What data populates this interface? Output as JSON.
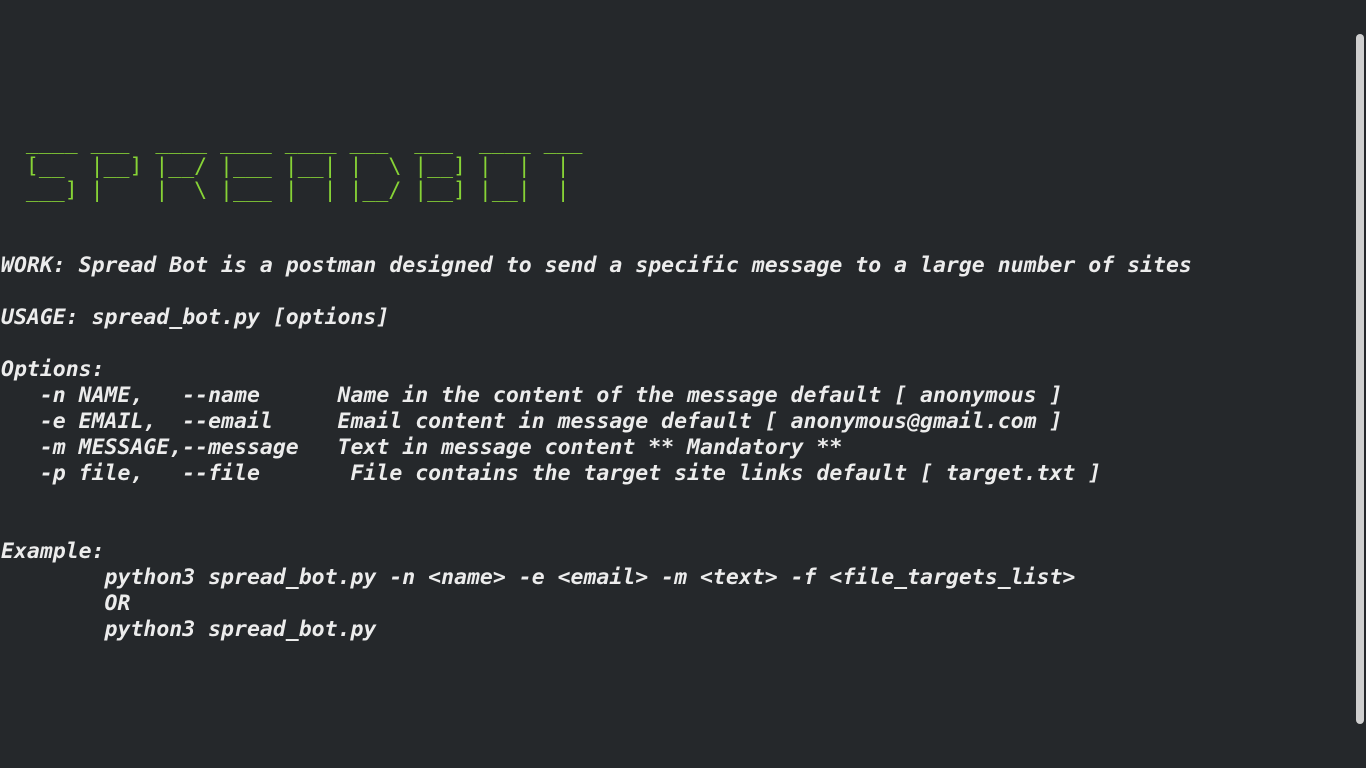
{
  "terminal": {
    "banner_art": [
      "  ____ ___  ____ ____ ____ ___  ___  ____ ___",
      "  [__  |__] |__/ |___ |__| |  \\ |__] |  |  | ",
      "  ___] |    |  \\ |___ |  | |__/ |__] |__|  | "
    ],
    "banner_text": "SPREADBOT",
    "work_line": "WORK: Spread Bot is a postman designed to send a specific message to a large number of sites",
    "usage_line": "USAGE: spread_bot.py [options]",
    "options_heading": "Options:",
    "options": [
      "   -n NAME,   --name      Name in the content of the message default [ anonymous ]",
      "   -e EMAIL,  --email     Email content in message default [ anonymous@gmail.com ]",
      "   -m MESSAGE,--message   Text in message content ** Mandatory **",
      "   -p file,   --file       File contains the target site links default [ target.txt ]"
    ],
    "example_heading": "Example:",
    "examples": [
      "        python3 spread_bot.py -n <name> -e <email> -m <text> -f <file_targets_list>",
      "        OR",
      "        python3 spread_bot.py"
    ]
  },
  "colors": {
    "background": "#25282b",
    "text": "#ececec",
    "banner": "#87d336",
    "scrollbar_thumb": "#cfcfcf"
  }
}
